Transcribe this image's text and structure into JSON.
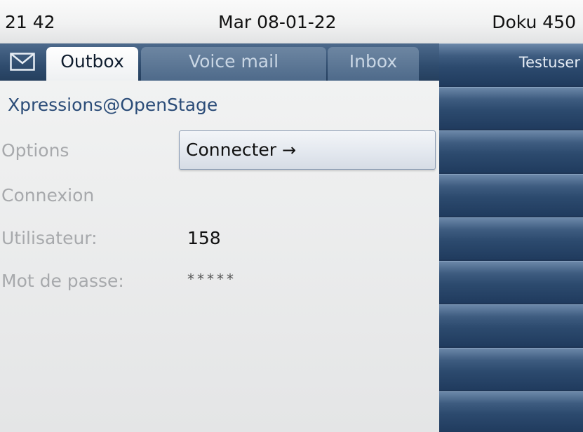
{
  "status": {
    "time": "21 42",
    "date": "Mar 08-01-22",
    "device": "Doku 450"
  },
  "tabs": {
    "mail_icon": "envelope-icon",
    "outbox": "Outbox",
    "voicemail": "Voice mail",
    "inbox": "Inbox"
  },
  "app": {
    "title": "Xpressions@OpenStage"
  },
  "form": {
    "options_label": "Options",
    "connect_button": "Connecter",
    "connect_arrow": "→",
    "connection_label": "Connexion",
    "user_label": "Utilisateur:",
    "user_value": "158",
    "password_label": "Mot de passe:",
    "password_value": "*****"
  },
  "keys": {
    "key1": "Testuser",
    "key2": "",
    "key3": "",
    "key4": "",
    "key5": "",
    "key6": "",
    "key7": "",
    "key8": "",
    "key9": ""
  }
}
